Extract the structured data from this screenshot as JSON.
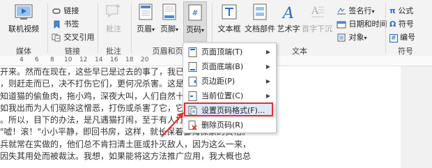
{
  "ribbon": {
    "groups": {
      "media": "媒体",
      "links": "链接",
      "comments": "批注",
      "header_footer": "页眉和页脚",
      "text": "文本",
      "symbols": "符号"
    },
    "buttons": {
      "online_video": "联机视频",
      "link": "链接",
      "bookmark": "书签",
      "cross_ref": "交叉引用",
      "comment": "批注",
      "header": "页眉",
      "footer": "页脚",
      "page_number": "页码",
      "textbox": "文本框",
      "doc_parts": "文档部件",
      "wordart": "艺术字",
      "dropcap": "首字下沉",
      "signature_line": "签名行",
      "date_time": "日期和时间",
      "object": "对象",
      "equation": "公式",
      "symbol": "符号",
      "number": "编号",
      "arrow": "▾"
    }
  },
  "ruler": {
    "ticks": [
      "4",
      "6",
      "8",
      "10",
      "12",
      "14",
      "16",
      "18",
      "20"
    ]
  },
  "menu": {
    "items": [
      {
        "label": "页面顶端(T)",
        "has_sub": true
      },
      {
        "label": "页面底端(B)",
        "has_sub": true
      },
      {
        "label": "页边距(P)",
        "has_sub": true
      },
      {
        "label": "当前位置(C)",
        "has_sub": true
      },
      {
        "label": "设置页码格式(F)...",
        "has_sub": false
      },
      {
        "label": "删除页码(R)",
        "has_sub": false
      }
    ],
    "submenu_arrow": "▶"
  },
  "document": {
    "lines": [
      "开来。然而在现在，这些早已是过去的事了，我已经",
      "，则赶走而已，决不打伤它们，更何况杀害。这是我",
      "知道猫的偷鱼肉，拖小鸡，深夜大叫，人们自然十",
      "如我出而为人们驱除这憎恶，打伤或杀害了它，它们",
      "。所以，目下的办法，是凡遇猫打闹，至于有人打",
      "\"嘘！滚！\"小小平静，即回书房，这样，就长保着御侮保家的资格。",
      "兵就常在实做的，他们总不肯扫清土匪或扑灭敌人，因为这么一来，",
      "因失其用处而被裁汰。我想，如果能将这方法推广应用，我大概也总"
    ]
  },
  "colors": {
    "ribbon_bg": "#f3f3f3",
    "highlight": "#dfe9f5",
    "annotation_red": "#e03030",
    "accent_blue": "#2b6cc4"
  }
}
